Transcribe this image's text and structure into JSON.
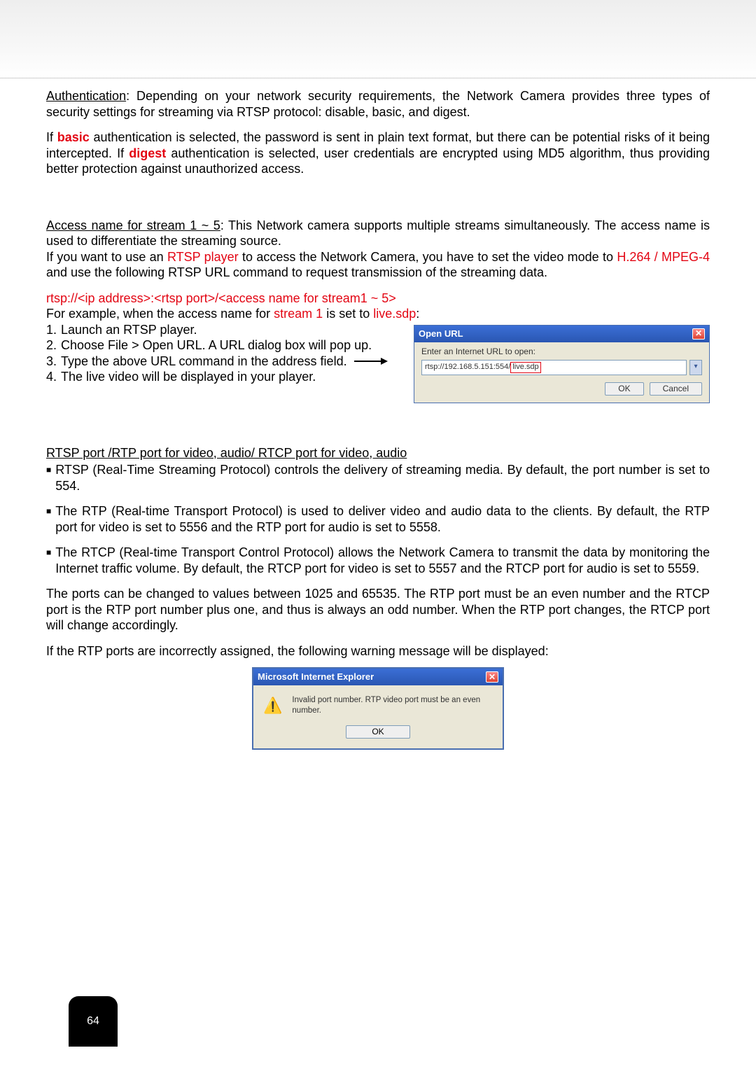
{
  "authentication_heading": "Authentication",
  "authentication_text": ": Depending on your network security requirements, the Network Camera provides three types of security settings for streaming via RTSP protocol: disable, basic, and digest.",
  "basic_p_text_1": "If ",
  "basic_word": "basic",
  "basic_p_text_2": " authentication is selected, the password is sent in plain text format, but there can be potential risks of it being intercepted. If ",
  "digest_word": "digest",
  "basic_p_text_3": " authentication is selected, user credentials are encrypted using MD5 algorithm, thus providing better protection against unauthorized access.",
  "access_heading": "Access name for stream 1 ~ 5",
  "access_text": ": This Network camera supports multiple streams simultaneously. The access name is used to differentiate the streaming source.",
  "rtsp_line_1": "If you want to use an ",
  "rtsp_player": "RTSP player",
  "rtsp_line_2": " to access the Network Camera, you have to set the video mode to ",
  "codec": "H.264 / MPEG-4",
  "rtsp_line_3": " and use the following RTSP URL command to request transmission of the streaming data.",
  "rtsp_url_format": "rtsp://<ip address>:<rtsp port>/<access name for stream1 ~ 5>",
  "example_1": "For example, when the access name for ",
  "stream1": "stream 1",
  "example_2": " is set to ",
  "livesdp": "live.sdp",
  "example_3": ":",
  "steps": {
    "s1_n": "1. ",
    "s1": "Launch an RTSP player.",
    "s2_n": "2. ",
    "s2": "Choose File > Open URL. A URL dialog box will pop up.",
    "s3_n": "3. ",
    "s3": "Type the above URL command in the address field.",
    "s4_n": "4. ",
    "s4": "The live video will be displayed in your player."
  },
  "url_dialog": {
    "title": "Open URL",
    "label": "Enter an Internet URL to open:",
    "input_value": "rtsp://192.168.5.151:554/",
    "input_highlight": "live.sdp",
    "ok": "OK",
    "cancel": "Cancel"
  },
  "ports_heading": "RTSP port /RTP port for video, audio/ RTCP port for video, audio",
  "ports_b1": "RTSP (Real-Time Streaming Protocol) controls the delivery of streaming media. By default, the port number is set to 554.",
  "ports_b2": "The RTP (Real-time Transport Protocol) is used to deliver video and audio data to the clients. By default, the RTP port for video is set to 5556 and the RTP port for audio is set to 5558.",
  "ports_b3": "The RTCP (Real-time Transport Control Protocol) allows the Network Camera to transmit the data by monitoring the Internet traffic volume. By default, the RTCP port for video is set to 5557 and the RTCP port for audio is set to 5559.",
  "ports_note": "The ports can be changed to values between 1025 and 65535. The RTP port must be an even number and the RTCP port is the RTP port number plus one, and thus is always an odd number. When the RTP port changes, the RTCP port will change accordingly.",
  "warn_intro": "If the RTP ports are incorrectly assigned, the following warning message will be displayed:",
  "ie_dialog": {
    "title": "Microsoft Internet Explorer",
    "message": "Invalid port number. RTP video port must be an even number.",
    "ok": "OK"
  },
  "page_number": "64"
}
